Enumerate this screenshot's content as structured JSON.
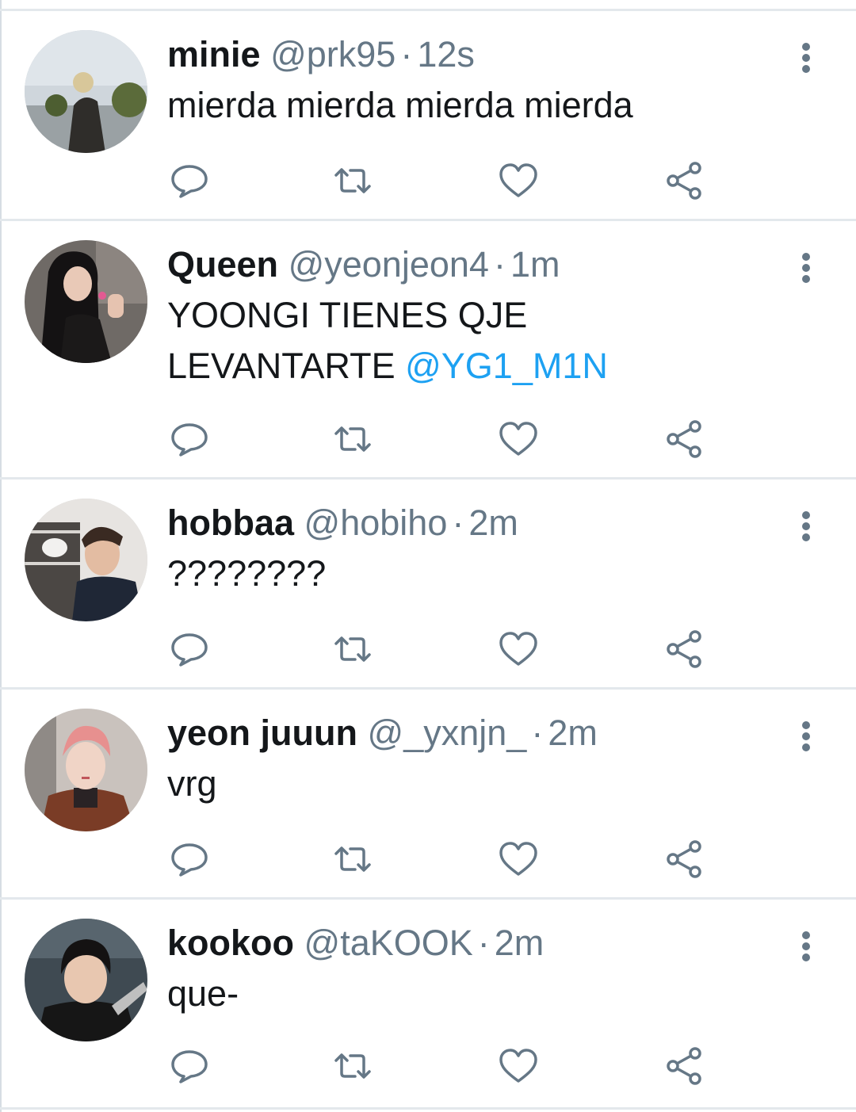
{
  "colors": {
    "name": "#14171a",
    "meta": "#657786",
    "mention": "#1da1f2",
    "icon": "#657786",
    "divider": "#e3e8ec"
  },
  "icons": {
    "reply": "reply-icon",
    "retweet": "retweet-icon",
    "like": "like-icon",
    "share": "share-icon",
    "more": "more-vertical-icon"
  },
  "tweets": [
    {
      "name": "minie",
      "handle": "@prk95",
      "dot": "·",
      "time": "12s",
      "text_line1": "mierda mierda mierda mierda",
      "text_line2": "",
      "mention": ""
    },
    {
      "name": "Queen",
      "handle": "@yeonjeon4",
      "dot": "·",
      "time": "1m",
      "text_line1": "YOONGI TIENES QJE",
      "text_line2": "LEVANTARTE",
      "mention": "@YG1_M1N"
    },
    {
      "name": "hobbaa",
      "handle": "@hobiho",
      "dot": "·",
      "time": "2m",
      "text_line1": "????????",
      "text_line2": "",
      "mention": ""
    },
    {
      "name": "yeon juuun",
      "handle": "@_yxnjn_",
      "dot": "·",
      "time": "2m",
      "text_line1": "vrg",
      "text_line2": "",
      "mention": ""
    },
    {
      "name": "kookoo",
      "handle": "@taKOOK",
      "dot": "·",
      "time": "2m",
      "text_line1": "que-",
      "text_line2": "",
      "mention": ""
    }
  ]
}
